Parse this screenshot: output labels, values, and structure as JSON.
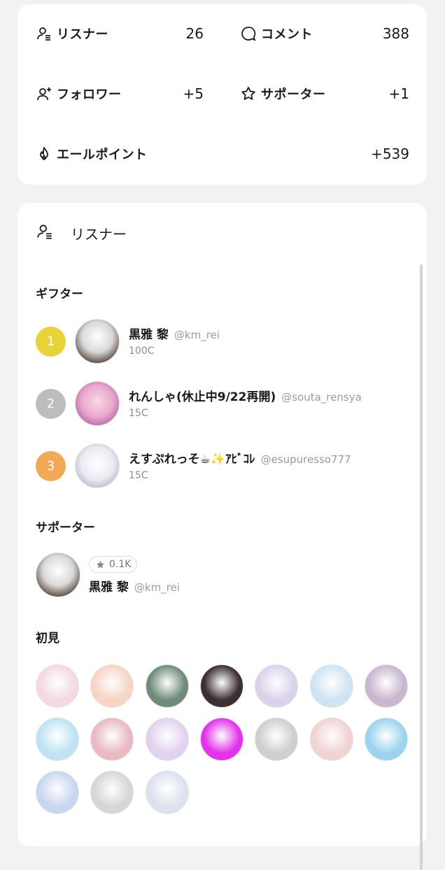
{
  "stats": {
    "listeners": {
      "label": "リスナー",
      "value": "26",
      "icon": "listener-icon"
    },
    "comments": {
      "label": "コメント",
      "value": "388",
      "icon": "comment-icon"
    },
    "followers": {
      "label": "フォロワー",
      "value": "+5",
      "icon": "add-user-icon"
    },
    "supporters": {
      "label": "サポーター",
      "value": "+1",
      "icon": "star-icon"
    },
    "yell_points": {
      "label": "エールポイント",
      "value": "+539",
      "icon": "flame-icon"
    }
  },
  "listener_section": {
    "title": "リスナー",
    "gifters_title": "ギフター",
    "gifters": [
      {
        "rank": "1",
        "name": "黒雅 黎",
        "handle": "@km_rei",
        "coins": "100C",
        "rank_color": "#e9d33a",
        "avatar_color": "#cfcfcf"
      },
      {
        "rank": "2",
        "name": "れんしゃ(休止中9/22再開)",
        "handle": "@souta_rensya",
        "coins": "15C",
        "rank_color": "#bdbdbd",
        "avatar_color": "#e9b3d6"
      },
      {
        "rank": "3",
        "name": "えすぷれっそ☕✨ｱﾋﾞｺﾚ",
        "handle": "@esupuresso777",
        "coins": "15C",
        "rank_color": "#f0aa57",
        "avatar_color": "#e6e3ee"
      }
    ],
    "supporters_title": "サポーター",
    "supporter": {
      "badge": "0.1K",
      "name": "黒雅 黎",
      "handle": "@km_rei",
      "avatar_color": "#cfcfcf"
    },
    "first_timers_title": "初見",
    "first_timers": [
      {
        "color": "#f3d9e4"
      },
      {
        "color": "#f6d4c6"
      },
      {
        "color": "#6f8c7a"
      },
      {
        "color": "#3b2f33"
      },
      {
        "color": "#d9d2ea"
      },
      {
        "color": "#cfe4f3"
      },
      {
        "color": "#c9b6cf"
      },
      {
        "color": "#bfe3f3"
      },
      {
        "color": "#e9b9c4"
      },
      {
        "color": "#e2d2f0"
      },
      {
        "color": "#e233ea"
      },
      {
        "color": "#cfcfcf"
      },
      {
        "color": "#f0d3d3"
      },
      {
        "color": "#9cd3f0"
      },
      {
        "color": "#c8d6ef"
      },
      {
        "color": "#d6d6d6"
      },
      {
        "color": "#dde2ef"
      }
    ]
  },
  "colors": {
    "background": "#f2f2f2",
    "card": "#ffffff",
    "muted": "#9b9b9b"
  }
}
